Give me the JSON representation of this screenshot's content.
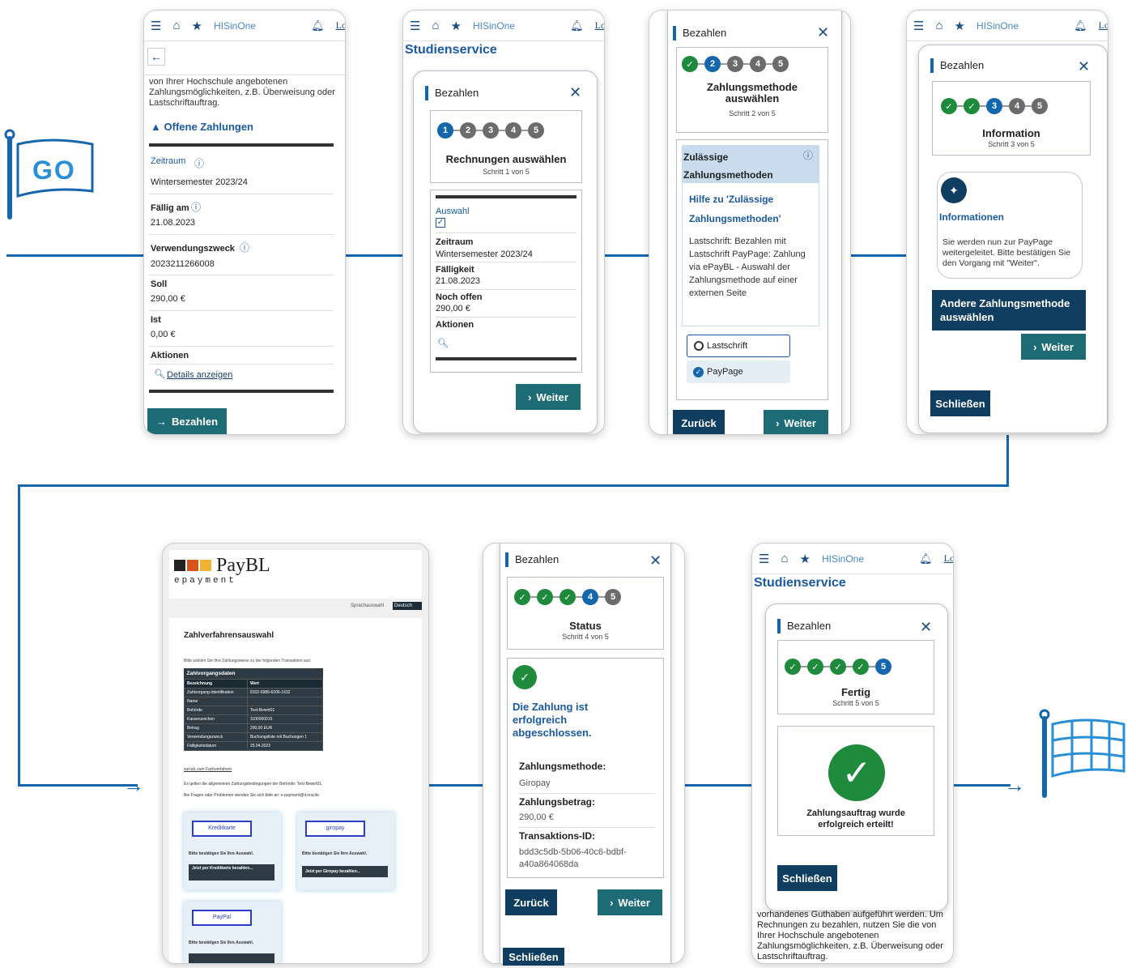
{
  "start_flag": {
    "label": "GO"
  },
  "screens": {
    "s1": {
      "topbar": {
        "logo": "HISinOne",
        "logout": "Log"
      },
      "intro": "von Ihrer Hochschule angebotenen Zahlungsmöglichkeiten, z.B. Überweisung oder Lastschriftauftrag.",
      "section": "Offene Zahlungen",
      "fields": [
        {
          "label": "Zeitraum",
          "value": "Wintersemester 2023/24"
        },
        {
          "label": "Fällig am",
          "value": "21.08.2023"
        },
        {
          "label": "Verwendungszweck",
          "value": "2023211266008"
        },
        {
          "label": "Soll",
          "value": "290,00 €"
        },
        {
          "label": "Ist",
          "value": "0,00 €"
        },
        {
          "label": "Aktionen",
          "value": "Details anzeigen"
        }
      ],
      "button": "Bezahlen"
    },
    "s2": {
      "topbar": {
        "logo": "HISinOne",
        "logout": "Log"
      },
      "page_title": "Studienservice",
      "modal_title": "Bezahlen",
      "step_title": "Rechnungen auswählen",
      "step_sub": "Schritt 1 von 5",
      "select_label": "Auswahl",
      "rows": [
        {
          "label": "Zeitraum",
          "value": "Wintersemester 2023/24"
        },
        {
          "label": "Fälligkeit",
          "value": "21.08.2023"
        },
        {
          "label": "Noch offen",
          "value": "290,00 €"
        },
        {
          "label": "Aktionen",
          "value": ""
        }
      ],
      "button": "Weiter"
    },
    "s3": {
      "modal_title": "Bezahlen",
      "step_title": "Zahlungsmethode auswählen",
      "step_sub": "Schritt 2 von 5",
      "section": "Zulässige Zahlungsmethoden",
      "help_title": "Hilfe zu 'Zulässige Zahlungsmethoden'",
      "help_text": "Lastschrift: Bezahlen mit Lastschrift PayPage: Zahlung via ePayBL - Auswahl der Zahlungsmethode auf einer externen Seite",
      "option1": "Lastschrift",
      "option2": "PayPage",
      "back": "Zurück",
      "next": "Weiter"
    },
    "s4": {
      "topbar": {
        "logo": "HISinOne",
        "logout": "Log"
      },
      "modal_title": "Bezahlen",
      "step_title": "Information",
      "step_sub": "Schritt 3 von 5",
      "info_title": "Informationen",
      "info_text": "Sie werden nun zur PayPage weitergeleitet. Bitte bestätigen Sie den Vorgang mit \"Weiter\".",
      "alt_button": "Andere Zahlungsmethode auswählen",
      "next": "Weiter",
      "close": "Schließen"
    },
    "s5": {
      "logo": "PayBL",
      "logo_sub": "epayment",
      "lang_label": "Sprachauswahl",
      "lang_value": "Deutsch",
      "heading": "Zahlverfahrensauswahl",
      "intro": "Bitte wählen Sie Ihre Zahlungsweise zu der folgenden Transaktion aus:",
      "table_title": "Zahlvorgangsdaten",
      "table_head": [
        "Bezeichnung",
        "Wert"
      ],
      "table_rows": [
        [
          "Zahlvorgang-Identifikation",
          "8102-6986-6206-1632"
        ],
        [
          "Name",
          ""
        ],
        [
          "Behörde",
          "Test-Bewirt01"
        ],
        [
          "Kassenzeichen",
          "1100000015"
        ],
        [
          "Betrag",
          "290,00 EUR"
        ],
        [
          "Verwendungszweck",
          "Buchungsliste mit Buchungen 1"
        ],
        [
          "Fälligkeitsdatum",
          "25.04.2023"
        ]
      ],
      "back_link": "zurück zum Fachverfahren",
      "terms": "Es gelten die allgemeinen Zahlungsbedingungen der Behörde: Test-Bewirt01.",
      "contact": "Bei Fragen oder Problemen wenden Sie sich bitte an: e-payment@it.nrw.de",
      "methods": [
        {
          "name": "Kreditkarte",
          "confirm": "Bitte bestätigen Sie Ihre Auswahl.",
          "button": "Jetzt per Kreditkarte bezahlen..."
        },
        {
          "name": "giropay",
          "confirm": "Bitte bestätigen Sie Ihre Auswahl.",
          "button": "Jetzt per Giropay bezahlen..."
        },
        {
          "name": "PayPal",
          "confirm": "Bitte bestätigen Sie Ihre Auswahl.",
          "button": ""
        }
      ]
    },
    "s6": {
      "modal_title": "Bezahlen",
      "step_title": "Status",
      "step_sub": "Schritt 4 von 5",
      "success": "Die Zahlung ist erfolgreich abgeschlossen.",
      "rows": [
        {
          "label": "Zahlungsmethode:",
          "value": "Giropay"
        },
        {
          "label": "Zahlungsbetrag:",
          "value": "290,00 €"
        },
        {
          "label": "Transaktions-ID:",
          "value": "bdd3c5db-5b06-40c6-bdbf-a40a864068da"
        }
      ],
      "back": "Zurück",
      "next": "Weiter",
      "close": "Schließen"
    },
    "s7": {
      "topbar": {
        "logo": "HISinOne",
        "logout": "Log"
      },
      "page_title": "Studienservice",
      "modal_title": "Bezahlen",
      "step_title": "Fertig",
      "step_sub": "Schritt 5 von 5",
      "result": "Zahlungsauftrag wurde erfolgreich erteilt!",
      "close": "Schließen",
      "footer": "vorhandenes Guthaben aufgeführt werden. Um Rechnungen zu bezahlen, nutzen Sie die von Ihrer Hochschule angebotenen Zahlungsmöglichkeiten, z.B. Überweisung oder Lastschriftauftrag."
    }
  },
  "colors": {
    "flow_line": "#1467ad",
    "button": "#1d6b74",
    "check": "#1e8a3c",
    "current_step": "#1467ad"
  }
}
